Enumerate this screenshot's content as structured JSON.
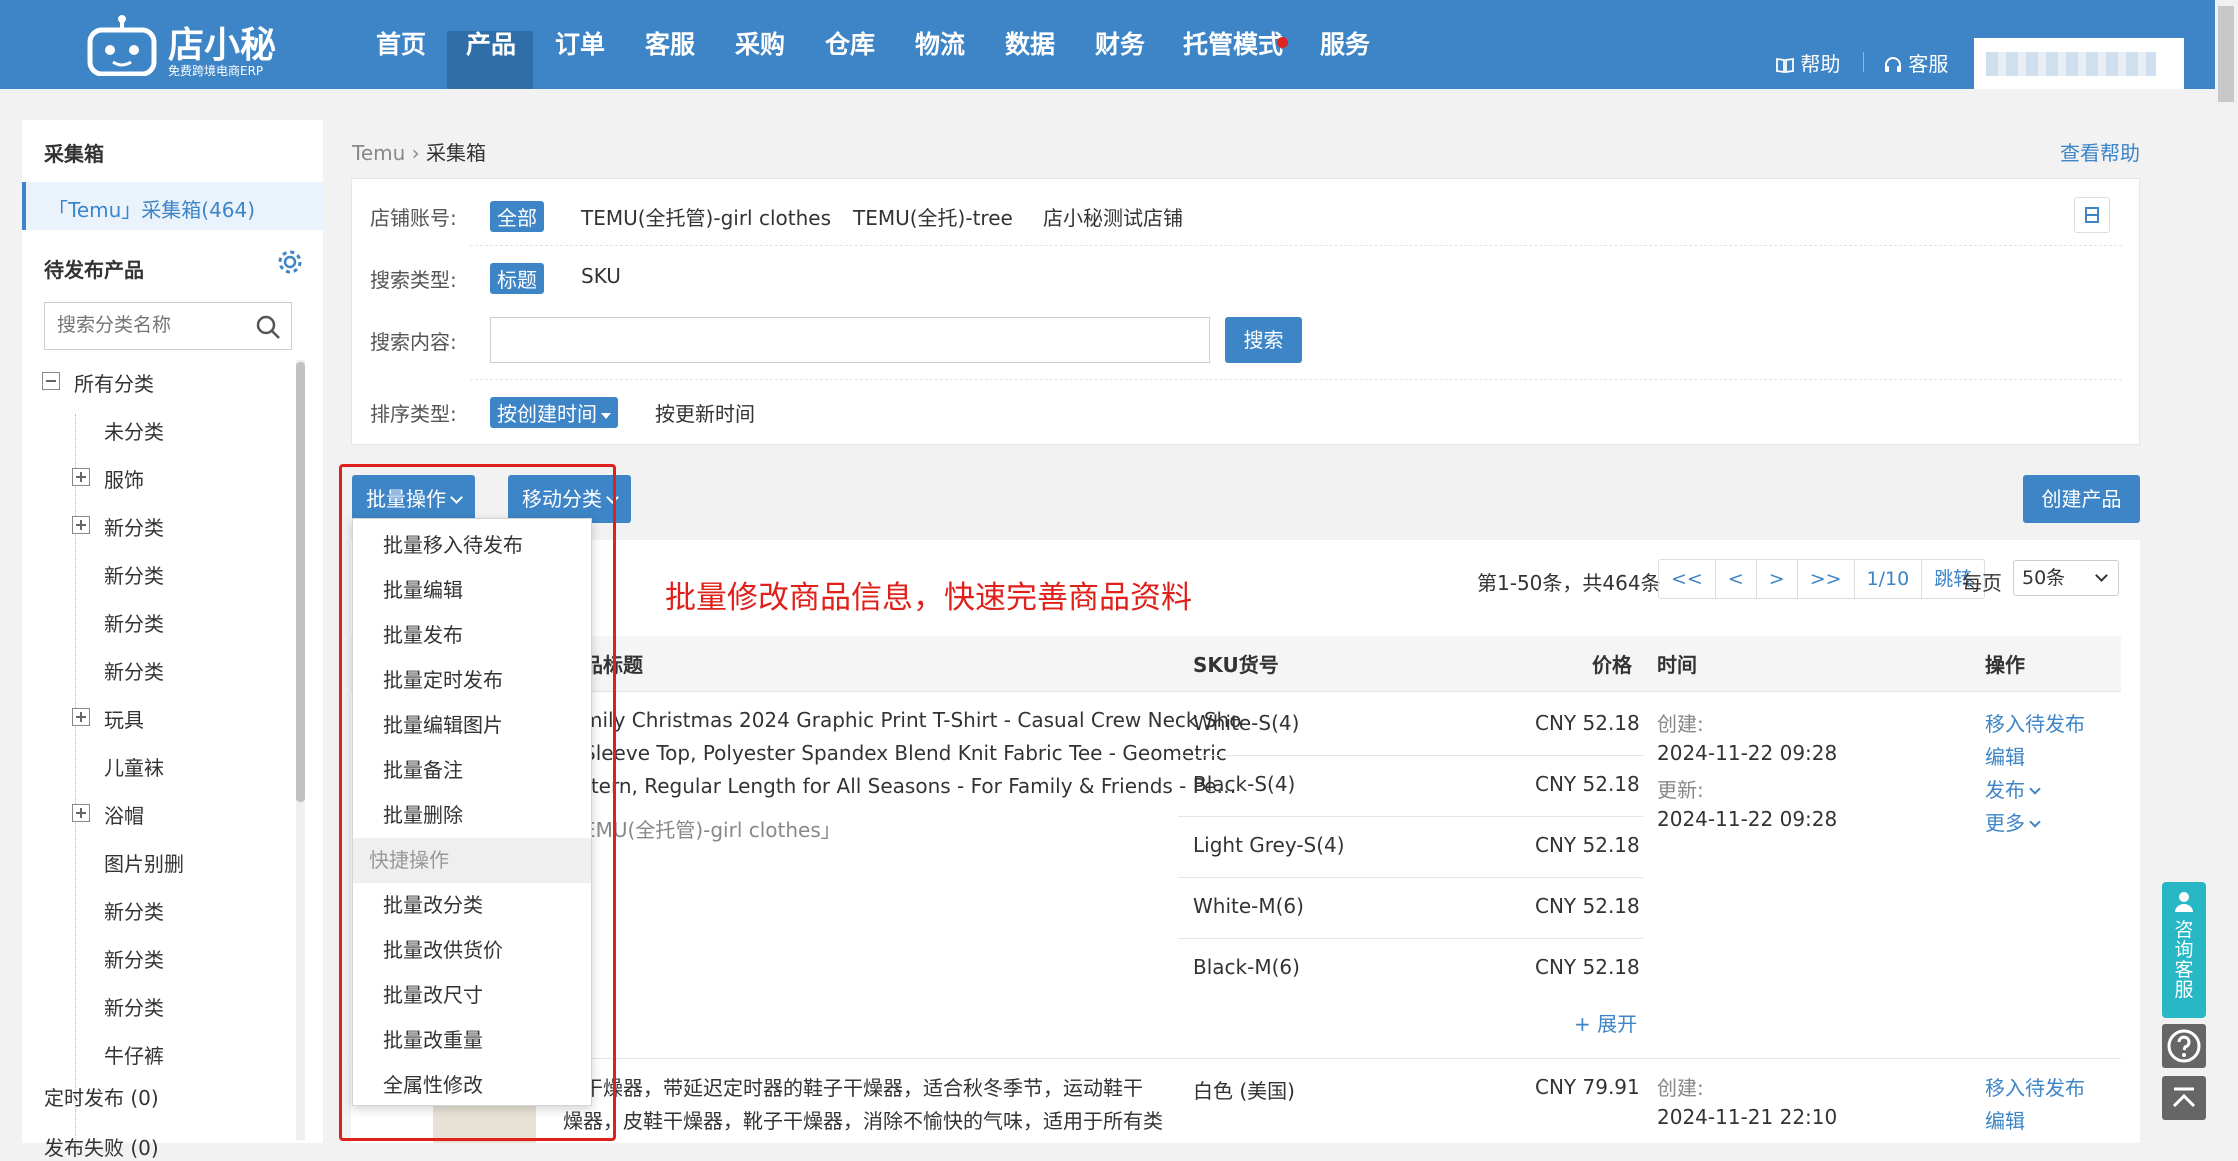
{
  "app": {
    "logo_name": "店小秘",
    "logo_sub": "免费跨境电商ERP"
  },
  "nav": [
    "首页",
    "产品",
    "订单",
    "客服",
    "采购",
    "仓库",
    "物流",
    "数据",
    "财务",
    "托管模式",
    "服务"
  ],
  "nav_active": "产品",
  "top_links": {
    "help": "帮助",
    "support": "客服"
  },
  "sidebar": {
    "title": "采集箱",
    "collection": "「Temu」采集箱(464)",
    "pending_title": "待发布产品",
    "search_placeholder": "搜索分类名称",
    "tree": [
      "所有分类",
      "未分类",
      "服饰",
      "新分类",
      "新分类",
      "新分类",
      "新分类",
      "玩具",
      "儿童袜",
      "浴帽",
      "图片别删",
      "新分类",
      "新分类",
      "新分类",
      "牛仔裤"
    ],
    "timed": "定时发布 (0)",
    "fail": "发布失败 (0)"
  },
  "breadcrumb": {
    "root": "Temu",
    "current": "采集箱"
  },
  "help_link": "查看帮助",
  "filter": {
    "store_label": "店铺账号:",
    "stores": [
      "全部",
      "TEMU(全托管)-girl clothes",
      "TEMU(全托)-tree",
      "店小秘测试店铺"
    ],
    "search_type_label": "搜索类型:",
    "search_types": [
      "标题",
      "SKU"
    ],
    "search_content_label": "搜索内容:",
    "search_button": "搜索",
    "sort_label": "排序类型:",
    "sorts": [
      "按创建时间",
      "按更新时间"
    ]
  },
  "toolbar": {
    "batch": "批量操作",
    "move": "移动分类",
    "create": "创建产品"
  },
  "dropdown": {
    "items": [
      "批量移入待发布",
      "批量编辑",
      "批量发布",
      "批量定时发布",
      "批量编辑图片",
      "批量备注",
      "批量删除"
    ],
    "group": "快捷操作",
    "quick": [
      "批量改分类",
      "批量改供货价",
      "批量改尺寸",
      "批量改重量",
      "全属性修改"
    ]
  },
  "annotation": "批量修改商品信息，快速完善商品资料",
  "pager": {
    "info": "第1-50条，共464条",
    "buttons": [
      "<<",
      "<",
      ">",
      ">>",
      "1/10",
      "跳转"
    ],
    "perpage_label": "每页",
    "perpage": "50条"
  },
  "table": {
    "headers": {
      "title": "品标题",
      "sku": "SKU货号",
      "price": "价格",
      "time": "时间",
      "ops": "操作"
    },
    "rows": [
      {
        "title_lines": [
          "mily Christmas 2024 Graphic Print T-Shirt - Casual Crew Neck Sho",
          "Sleeve Top, Polyester Spandex Blend Knit Fabric Tee - Geometric",
          "ttern, Regular Length for All Seasons - For Family & Friends - Pe…"
        ],
        "store": "EMU(全托管)-girl clothes」",
        "skus": [
          [
            "White-S(4)",
            "CNY 52.18"
          ],
          [
            "Black-S(4)",
            "CNY 52.18"
          ],
          [
            "Light Grey-S(4)",
            "CNY 52.18"
          ],
          [
            "White-M(6)",
            "CNY 52.18"
          ],
          [
            "Black-M(6)",
            "CNY 52.18"
          ]
        ],
        "expand": "+ 展开",
        "created_label": "创建:",
        "created": "2024-11-22 09:28",
        "updated_label": "更新:",
        "updated": "2024-11-22 09:28",
        "ops": [
          "移入待发布",
          "编辑",
          "发布",
          "更多"
        ]
      },
      {
        "title_lines": [
          "子干燥器，带延迟定时器的鞋子干燥器，适合秋冬季节，运动鞋干",
          "燥器，皮鞋干燥器，靴子干燥器，消除不愉快的气味，适用于所有类"
        ],
        "skus": [
          [
            "白色 (美国)",
            "CNY 79.91"
          ]
        ],
        "created_label": "创建:",
        "created": "2024-11-21 22:10",
        "ops": [
          "移入待发布",
          "编辑"
        ]
      }
    ]
  },
  "float": {
    "consult": "咨询客服"
  },
  "colors": {
    "primary": "#3d85c6",
    "annotation": "#e0201b",
    "consult": "#28b7c4"
  }
}
